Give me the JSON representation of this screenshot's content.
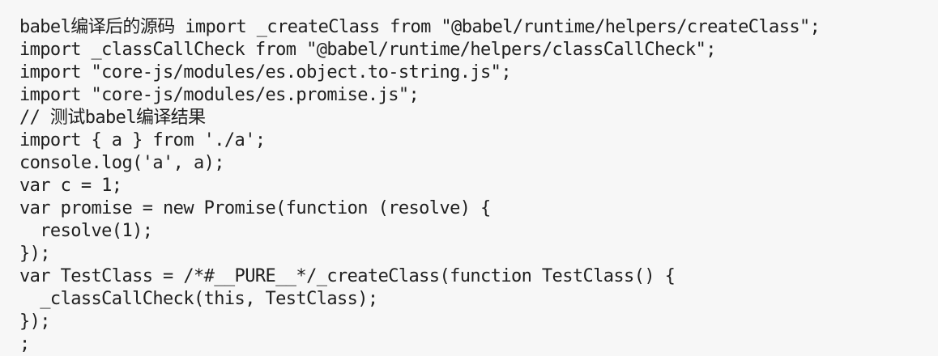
{
  "code": {
    "lines": [
      "babel编译后的源码 import _createClass from \"@babel/runtime/helpers/createClass\";",
      "import _classCallCheck from \"@babel/runtime/helpers/classCallCheck\";",
      "import \"core-js/modules/es.object.to-string.js\";",
      "import \"core-js/modules/es.promise.js\";",
      "// 测试babel编译结果",
      "import { a } from './a';",
      "console.log('a', a);",
      "var c = 1;",
      "var promise = new Promise(function (resolve) {",
      "  resolve(1);",
      "});",
      "var TestClass = /*#__PURE__*/_createClass(function TestClass() {",
      "  _classCallCheck(this, TestClass);",
      "});",
      ";"
    ]
  }
}
